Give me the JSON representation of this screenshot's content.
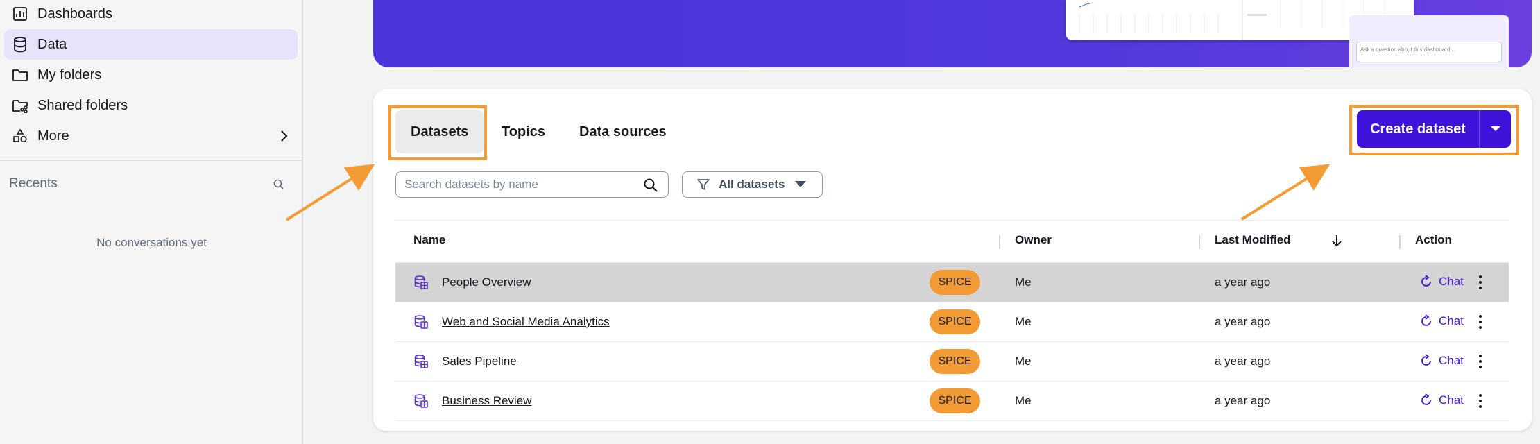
{
  "sidebar": {
    "items": [
      {
        "label": "Dashboards",
        "icon": "dashboard-icon"
      },
      {
        "label": "Data",
        "icon": "database-icon",
        "active": true
      },
      {
        "label": "My folders",
        "icon": "folder-icon"
      },
      {
        "label": "Shared folders",
        "icon": "shared-folder-icon"
      },
      {
        "label": "More",
        "icon": "shapes-icon"
      }
    ],
    "recents_label": "Recents",
    "no_conversations": "No conversations yet"
  },
  "hero": {
    "preview_question_placeholder": "Ask a question about this dashboard..."
  },
  "tabs": [
    {
      "label": "Datasets",
      "selected": true
    },
    {
      "label": "Topics"
    },
    {
      "label": "Data sources"
    }
  ],
  "toolbar": {
    "create_label": "Create dataset",
    "search_placeholder": "Search datasets by name",
    "filter_label": "All datasets"
  },
  "table": {
    "headers": {
      "name": "Name",
      "owner": "Owner",
      "modified": "Last Modified",
      "action": "Action"
    },
    "rows": [
      {
        "name": "People Overview",
        "badge": "SPICE",
        "owner": "Me",
        "modified": "a year ago",
        "action": "Chat"
      },
      {
        "name": "Web and Social Media Analytics",
        "badge": "SPICE",
        "owner": "Me",
        "modified": "a year ago",
        "action": "Chat"
      },
      {
        "name": "Sales Pipeline",
        "badge": "SPICE",
        "owner": "Me",
        "modified": "a year ago",
        "action": "Chat"
      },
      {
        "name": "Business Review",
        "badge": "SPICE",
        "owner": "Me",
        "modified": "a year ago",
        "action": "Chat"
      }
    ]
  },
  "colors": {
    "accent": "#3e12d8",
    "highlight": "#f39b34",
    "badge": "#f29b34",
    "sidebar_active": "#e6e4fa"
  }
}
